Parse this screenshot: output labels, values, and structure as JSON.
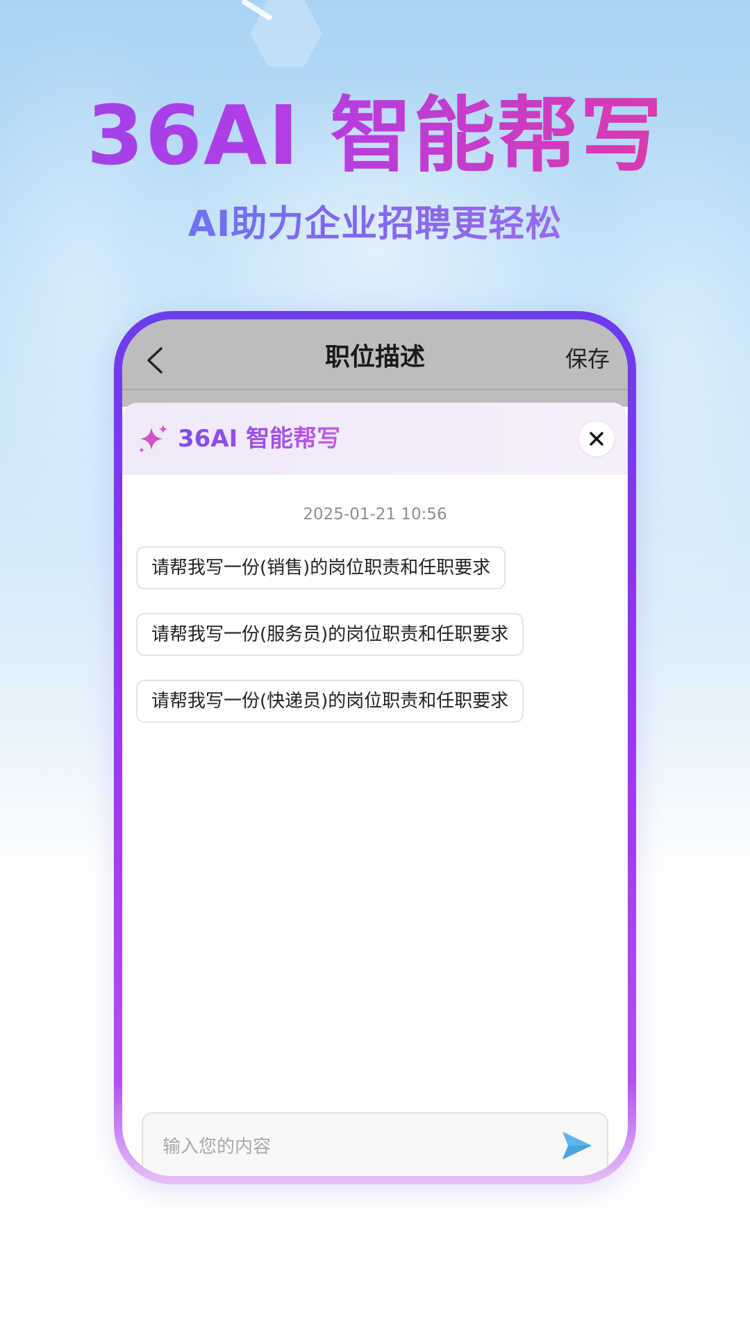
{
  "hero": {
    "title": "36AI 智能帮写",
    "subtitle": "AI助力企业招聘更轻松"
  },
  "navbar": {
    "back_icon": "chevron-left-icon",
    "title": "职位描述",
    "save_label": "保存"
  },
  "assistant": {
    "icon": "sparkle-icon",
    "title": "36AI 智能帮写",
    "close_icon": "close-icon"
  },
  "chat": {
    "timestamp": "2025-01-21 10:56",
    "suggestions": [
      "请帮我写一份(销售)的岗位职责和任职要求",
      "请帮我写一份(服务员)的岗位职责和任职要求",
      "请帮我写一份(快递员)的岗位职责和任职要求"
    ]
  },
  "input": {
    "placeholder": "输入您的内容",
    "send_icon": "send-icon"
  },
  "colors": {
    "frame_gradient_start": "#6a3ded",
    "frame_gradient_end": "#b24ff0",
    "hero_title_start": "#9b43e8",
    "hero_title_end": "#e43a9f",
    "hero_subtitle_start": "#5a83ee",
    "hero_subtitle_end": "#b06de4",
    "send_icon": "#5db5ea"
  }
}
